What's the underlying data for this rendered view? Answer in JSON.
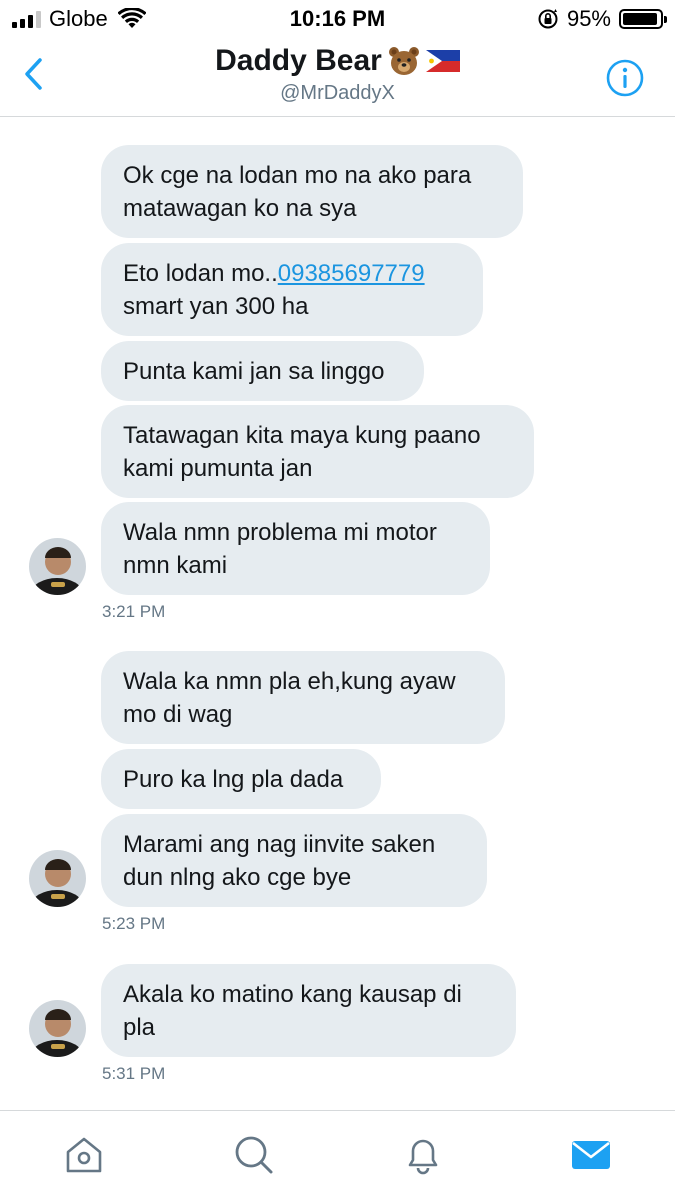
{
  "status_bar": {
    "carrier": "Globe",
    "time": "10:16 PM",
    "battery": "95%",
    "battery_level": 0.95,
    "icons": [
      "signal-icon",
      "wifi-icon",
      "orientation-lock-icon",
      "battery-icon"
    ]
  },
  "header": {
    "title": "Daddy Bear",
    "handle": "@MrDaddyX",
    "icons": [
      "back-chevron-icon",
      "bear-emoji-icon",
      "philippines-flag-icon",
      "info-icon"
    ]
  },
  "messages": [
    {
      "text": "Ok cge na lodan mo na ako para\nmatawagan ko na sya"
    },
    {
      "text_before": "Eto lodan mo..",
      "link": "09385697779",
      "text_after": "smart yan 300 ha"
    },
    {
      "text": "Punta kami jan sa linggo"
    },
    {
      "text": "Tatawagan kita maya kung paano\nkami pumunta jan"
    },
    {
      "text": "Wala nmn problema mi motor\nnmn kami"
    },
    {
      "text": "Wala ka nmn pla eh,kung ayaw\nmo di wag"
    },
    {
      "text": "Puro ka lng pla dada"
    },
    {
      "text": "Marami ang nag iinvite saken\ndun nlng ako cge bye"
    },
    {
      "text": "Akala ko matino kang kausap di\npla"
    }
  ],
  "timestamps": [
    "3:21 PM",
    "5:23 PM",
    "5:31 PM"
  ],
  "tabbar": {
    "icons": [
      "home-icon",
      "search-icon",
      "notifications-bell-icon",
      "messages-envelope-icon"
    ],
    "active": "messages",
    "accent_color": "#1da1f2"
  },
  "colors": {
    "bubble": "#e6ecf0",
    "link": "#1b95e0",
    "secondary_text": "#657786",
    "accent": "#1da1f2"
  }
}
